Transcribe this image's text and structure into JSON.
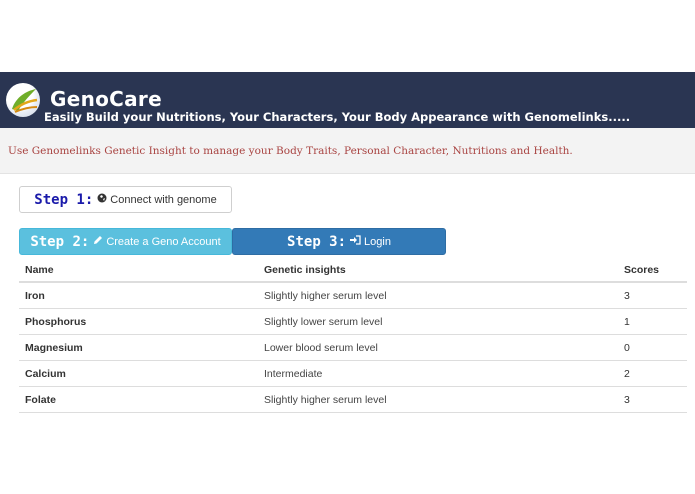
{
  "header": {
    "brand": "GenoCare",
    "tagline": "Easily Build your Nutritions, Your Characters, Your Body Appearance with Genomelinks....."
  },
  "notice": {
    "text": "Use Genomelinks Genetic Insight to manage your Body Traits, Personal Character, Nutritions and Health."
  },
  "steps": [
    {
      "num": "Step 1:",
      "label": "Connect with genome",
      "icon": "globe-icon"
    },
    {
      "num": "Step 2:",
      "label": "Create a Geno Account",
      "icon": "pencil-icon"
    },
    {
      "num": "Step 3:",
      "label": "Login",
      "icon": "login-icon"
    }
  ],
  "table": {
    "headers": [
      "Name",
      "Genetic insights",
      "Scores"
    ],
    "rows": [
      {
        "name": "Iron",
        "insight": "Slightly higher serum level",
        "score": "3"
      },
      {
        "name": "Phosphorus",
        "insight": "Slightly lower serum level",
        "score": "1"
      },
      {
        "name": "Magnesium",
        "insight": "Lower blood serum level",
        "score": "0"
      },
      {
        "name": "Calcium",
        "insight": "Intermediate",
        "score": "2"
      },
      {
        "name": "Folate",
        "insight": "Slightly higher serum level",
        "score": "3"
      }
    ]
  },
  "colors": {
    "header_bg": "#2a3552",
    "notice_text": "#a94442",
    "step2_bg": "#5bc0de",
    "step3_bg": "#337ab7",
    "step1_num": "#1a1aaa"
  }
}
